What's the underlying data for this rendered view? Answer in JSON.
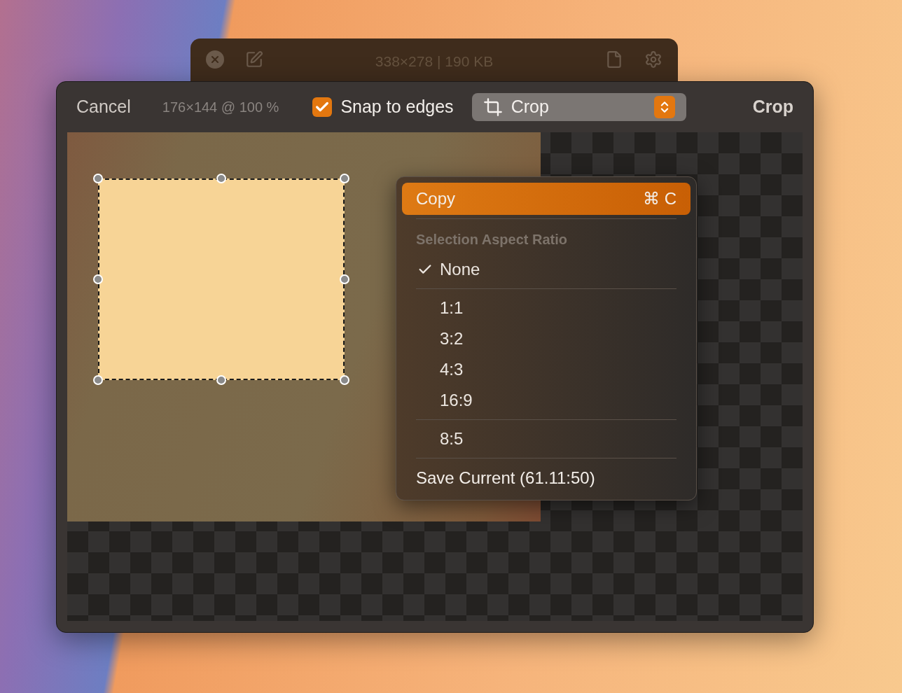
{
  "back_window": {
    "info": "338×278 | 190 KB"
  },
  "toolbar": {
    "cancel": "Cancel",
    "dimensions": "176×144 @ 100 %",
    "snap": {
      "label": "Snap to edges",
      "checked": true
    },
    "mode_popup": {
      "value": "Crop"
    },
    "confirm": "Crop"
  },
  "menu": {
    "items": [
      {
        "kind": "action",
        "label": "Copy",
        "shortcut": "⌘ C",
        "highlighted": true
      },
      {
        "kind": "separator"
      },
      {
        "kind": "header",
        "label": "Selection Aspect Ratio"
      },
      {
        "kind": "option",
        "label": "None",
        "checked": true
      },
      {
        "kind": "separator"
      },
      {
        "kind": "option",
        "label": "1:1",
        "checked": false
      },
      {
        "kind": "option",
        "label": "3:2",
        "checked": false
      },
      {
        "kind": "option",
        "label": "4:3",
        "checked": false
      },
      {
        "kind": "option",
        "label": "16:9",
        "checked": false
      },
      {
        "kind": "separator"
      },
      {
        "kind": "option",
        "label": "8:5",
        "checked": false
      },
      {
        "kind": "separator"
      },
      {
        "kind": "action",
        "label": "Save Current (61.11:50)",
        "highlighted": false
      }
    ]
  }
}
